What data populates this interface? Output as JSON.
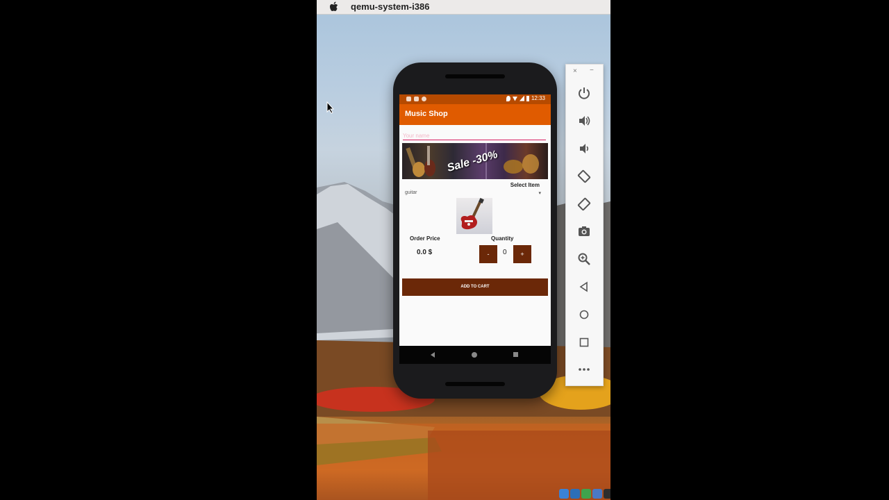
{
  "host": {
    "menubar": {
      "title": "qemu-system-i386"
    }
  },
  "app": {
    "title": "Music Shop",
    "name_field": {
      "placeholder": "Your name",
      "value": ""
    },
    "banner_text": "Sale -30%",
    "select_label": "Select Item",
    "selected_item": "guitar",
    "order_price_label": "Order Price",
    "order_price_value": "0.0 $",
    "quantity_label": "Quantity",
    "quantity_value": "0",
    "minus_label": "-",
    "plus_label": "+",
    "add_to_cart_label": "ADD TO CART",
    "status_time": "12:33"
  },
  "emulator_toolbar": {
    "close": "×",
    "minimize": "−",
    "buttons": [
      "power",
      "volume-up",
      "volume-down",
      "rotate-left",
      "rotate-right",
      "screenshot",
      "zoom",
      "back",
      "home",
      "overview",
      "more"
    ]
  },
  "colors": {
    "app_bar": "#e05b00",
    "status_bar": "#b64a00",
    "button": "#6b2808",
    "input_underline": "#d81b60"
  }
}
